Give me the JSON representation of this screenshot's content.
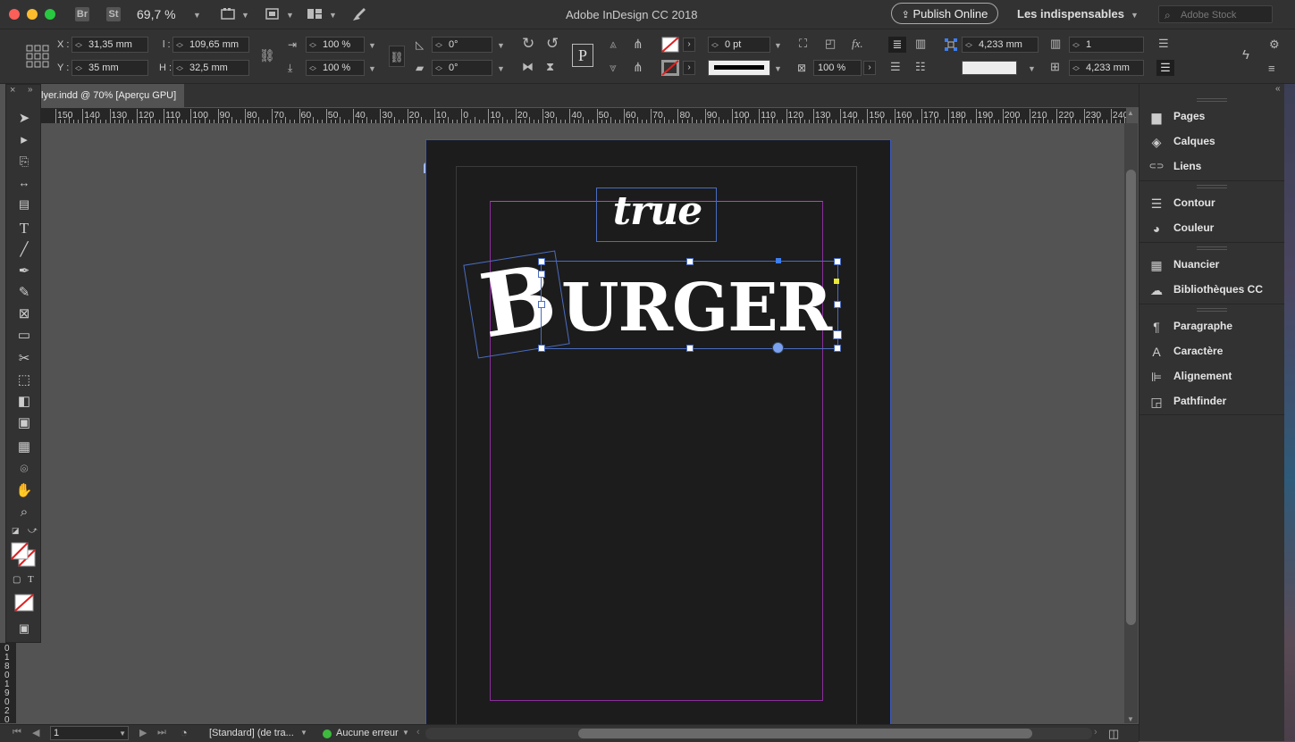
{
  "window": {
    "title": "Adobe InDesign CC 2018",
    "zoom": "69,7 %",
    "app_icons": [
      "Br",
      "St"
    ],
    "publish_label": "Publish Online",
    "workspace": "Les indispensables",
    "search_placeholder": "Adobe Stock"
  },
  "control": {
    "x_label": "X :",
    "x_value": "31,35 mm",
    "y_label": "Y :",
    "y_value": "35 mm",
    "l_label": "l :",
    "l_value": "109,65 mm",
    "h_label": "H :",
    "h_value": "32,5 mm",
    "scale_x": "100 %",
    "scale_y": "100 %",
    "rotate": "0°",
    "shear": "0°",
    "stroke_weight": "0 pt",
    "opacity": "100 %",
    "gap_1": "4,233 mm",
    "gap_2": "4,233 mm",
    "columns": "1"
  },
  "document": {
    "tab_label": "lyer.indd @ 70% [Aperçu GPU]",
    "text_true": "true",
    "text_burger_b": "B",
    "text_burger_rest": "URGER"
  },
  "ruler": {
    "h_labels": [
      "150",
      "140",
      "130",
      "120",
      "110",
      "100",
      "90",
      "80",
      "70",
      "60",
      "50",
      "40",
      "30",
      "20",
      "10",
      "0",
      "10",
      "20",
      "30",
      "40",
      "50",
      "60",
      "70",
      "80",
      "90",
      "100",
      "110",
      "120",
      "130",
      "140",
      "150",
      "160",
      "170",
      "180",
      "190",
      "200",
      "210",
      "220",
      "230",
      "240"
    ],
    "v_labels": [
      "0",
      "1",
      "8",
      "0",
      "1",
      "9",
      "0",
      "2",
      "0"
    ]
  },
  "status": {
    "page_number": "1",
    "preflight_profile": "[Standard] (de tra...",
    "preflight_status": "Aucune erreur",
    "status_color": "#3dbb3d"
  },
  "panels": {
    "items": [
      {
        "label": "Pages",
        "icon": "pages-icon"
      },
      {
        "label": "Calques",
        "icon": "layers-icon"
      },
      {
        "label": "Liens",
        "icon": "links-icon"
      },
      {
        "label": "Contour",
        "icon": "stroke-icon"
      },
      {
        "label": "Couleur",
        "icon": "color-icon"
      },
      {
        "label": "Nuancier",
        "icon": "swatches-icon"
      },
      {
        "label": "Bibliothèques CC",
        "icon": "cc-libraries-icon"
      },
      {
        "label": "Paragraphe",
        "icon": "paragraph-icon"
      },
      {
        "label": "Caractère",
        "icon": "character-icon"
      },
      {
        "label": "Alignement",
        "icon": "align-icon"
      },
      {
        "label": "Pathfinder",
        "icon": "pathfinder-icon"
      }
    ]
  }
}
